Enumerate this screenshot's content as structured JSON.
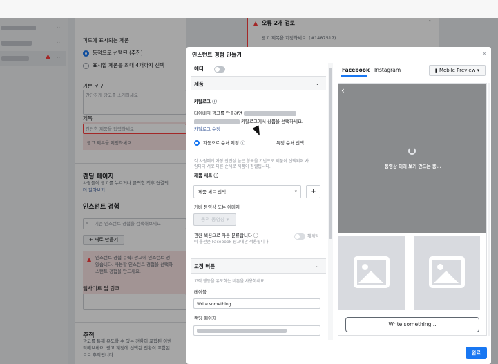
{
  "left_nav": {
    "dots": "..."
  },
  "settings": {
    "display_products_heading": "피드에 표시되는 제품",
    "option_auto": "동적으로 선택된 (추천)",
    "option_max": "표시할 제품을 최대 4개까지 선택",
    "primary_text_label": "기본 문구",
    "primary_text_placeholder": "간단하게 광고를 소개하세요",
    "title_label": "제목",
    "title_placeholder": "간단한 제품을 입력하세요",
    "title_error": "광고 제목을 지정하세요.",
    "landing_heading": "랜딩 페이지",
    "landing_desc": "사람들이 광고를 누르거나 클릭한 직후 연결되",
    "learn_more": "더 알아보기",
    "instant_exp_heading": "인스턴트 경험",
    "search_placeholder": "기존 인스턴트 경험을 검색해보세요",
    "new_button": "+ 새로 만들기",
    "warning_line1": "인스턴트 경험 누락: 광고에 인스턴트 경",
    "warning_line2": "있습니다. 사용할 인스턴트 경험을 선택하",
    "warning_line3": "스턴트 경험을 만드세요.",
    "website_link_label": "웹사이트 딥 링크",
    "tracking_heading": "추적",
    "tracking_line1": "광고를 통해 유도할 수 있는 전환이 포함된 이벤",
    "tracking_line2": "적해보세요. 광고 계정에 선택된 전환이 포함된",
    "tracking_line3": "으로 추적됩니다."
  },
  "errors_panel": {
    "title": "오류 2개 검토",
    "item": "광고 제목을 지정하세요. (#1487517)"
  },
  "modal": {
    "title": "인스턴트 경험 만들기",
    "close": "×",
    "header_label": "헤더",
    "product_section": "제품",
    "catalog_label": "카탈로그",
    "catalog_text_a": "다이내믹 광고를 만들려면",
    "catalog_text_b": "카탈로그에서 상품을 선택하세요.",
    "catalog_edit": "카탈로그 수정",
    "auto_order": "자동으로 순서 지정",
    "specific_order": "특정 순서 선택",
    "order_desc_1": "각 사람에게 가장 관련성 높은 항목을 기반으로 제품이 선택되며 사",
    "order_desc_2": "람마다 서로 다른 순서로 제품이 정렬됩니다.",
    "product_set_label": "제품 세트",
    "product_set_select": "제품 세트 선택",
    "plus": "+",
    "cover_label": "커버 동영상 또는 이미지",
    "choose_video": "동적 동영상",
    "related_label": "관련 섹션으로 자동 분류합니다",
    "related_desc": "이 옵션은 Facebook 광고에만 적용됩니다.",
    "related_state": "해제됨",
    "fixed_button_section": "고정 버튼",
    "fixed_button_desc": "고객 행동을 유도하는 버튼을 사용하세요.",
    "label_field": "레이블",
    "label_value": "Write something...",
    "landing_page_field": "랜딩 페이지",
    "done_button": "완료"
  },
  "preview": {
    "tab_facebook": "Facebook",
    "tab_instagram": "Instagram",
    "device": "Mobile Preview",
    "loading_text": "동영상 미리 보기 만드는 중...",
    "button_text": "Write something..."
  },
  "colors": {
    "accent": "#1877f2",
    "error": "#fa3e3e",
    "overlay": "rgba(0,0,0,0.35)"
  }
}
